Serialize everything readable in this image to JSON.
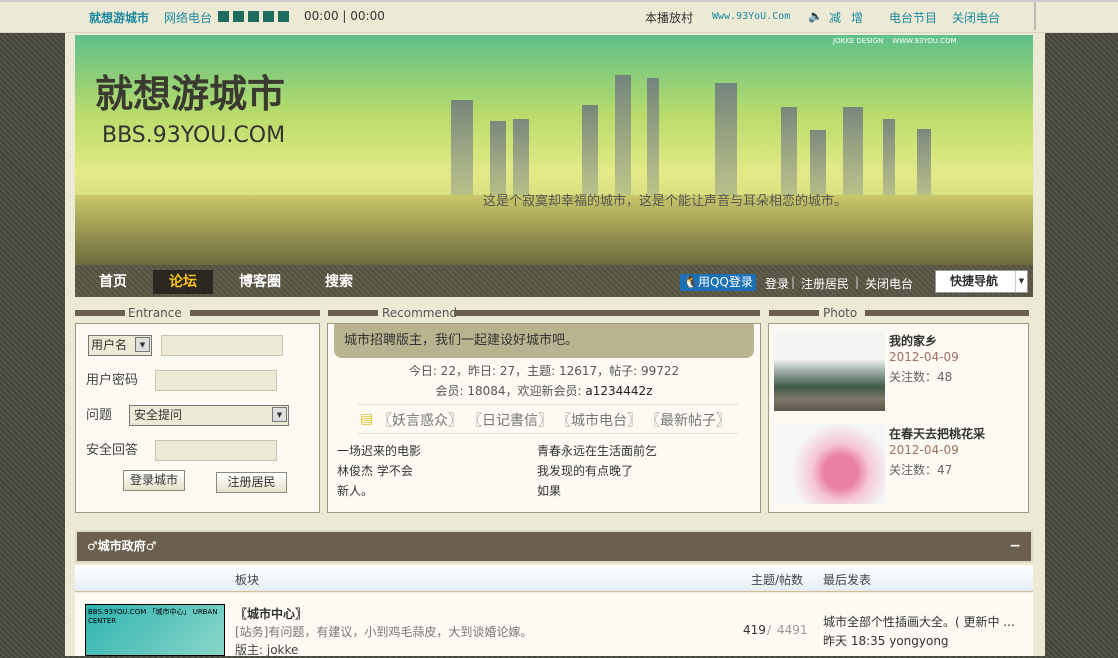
{
  "topbar": {
    "site_name": "就想游城市",
    "radio": "网络电台",
    "time": "00:00 | 00:00",
    "now_playing": "本播放村",
    "url": "Www.93YoU.Com",
    "decrease": "减",
    "increase": "增",
    "program": "电台节目",
    "close_radio": "关闭电台"
  },
  "banner": {
    "logo_cn": "就想游城市",
    "logo_en": "BBS.93YOU.COM",
    "credit": "JOKKE DESIGN    WWW.93YOU.COM",
    "slogan": "这是个寂寞却幸福的城市，这是个能让声音与耳朵相恋的城市。"
  },
  "nav": {
    "items": [
      "首页",
      "论坛",
      "博客圈",
      "搜索"
    ],
    "qq_login": "用QQ登录",
    "login": "登录",
    "register": "注册居民",
    "close_radio": "关闭电台",
    "quick_nav": "快捷导航"
  },
  "entrance": {
    "title": "Entrance",
    "username_select": "用户名",
    "password_label": "用户密码",
    "question_label": "问题",
    "question_select": "安全提问",
    "answer_label": "安全回答",
    "login_btn": "登录城市",
    "register_btn": "注册居民"
  },
  "recommend": {
    "title": "Recommend",
    "notice": "城市招聘版主，我们一起建设好城市吧。",
    "stats1": "今日: 22，昨日: 27，主题: 12617，帖子: 99722",
    "stats2_prefix": "会员: 18084，欢迎新会员: ",
    "new_member": "a1234442z",
    "tabs": [
      "〖妖言惑众〗",
      "〖日记書信〗",
      "〖城市电台〗",
      "〖最新帖子〗"
    ],
    "posts": [
      "一场迟来的电影",
      "青春永远在生活面前乞",
      "林俊杰 学不会",
      "我发现的有点晚了",
      "新人。",
      "如果"
    ]
  },
  "photo": {
    "title": "Photo",
    "items": [
      {
        "title": "我的家乡",
        "date": "2012-04-09",
        "follows": "关注数：48"
      },
      {
        "title": "在春天去把桃花采",
        "date": "2012-04-09",
        "follows": "关注数：47"
      }
    ]
  },
  "forum": {
    "category": "♂城市政府♂",
    "collapse": "−",
    "col_board": "板块",
    "col_counts": "主题/帖数",
    "col_last": "最后发表",
    "boards": [
      {
        "icon_text": "BBS.93YOU.COM 「城市中心」 URBAN CENTER",
        "name": "〖城市中心〗",
        "desc": "[站务]有问题，有建议，小到鸡毛蒜皮，大到谈婚论嫁。",
        "moderator": "版主: jokke",
        "topics": "419",
        "posts": "4491",
        "last_title": "城市全部个性插画大全。( 更新中 ...",
        "last_info": "昨天 18:35 yongyong"
      }
    ]
  }
}
